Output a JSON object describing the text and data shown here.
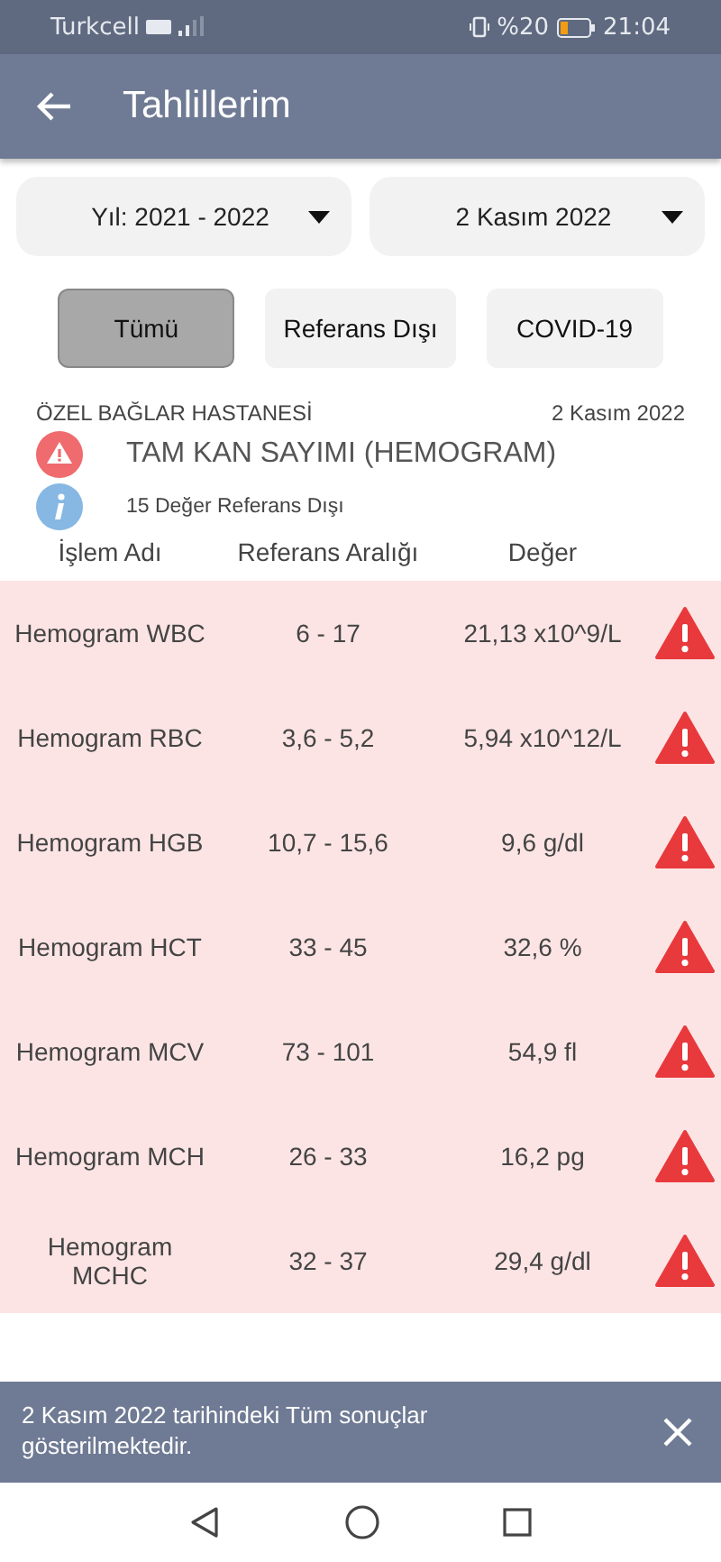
{
  "status_bar": {
    "carrier": "Turkcell",
    "battery": "%20",
    "time": "21:04"
  },
  "header": {
    "title": "Tahlillerim"
  },
  "dropdowns": [
    {
      "value": "Yıl: 2021 - 2022"
    },
    {
      "value": "2 Kasım 2022"
    }
  ],
  "filters": [
    {
      "label": "Tümü",
      "selected": true
    },
    {
      "label": "Referans Dışı",
      "selected": false
    },
    {
      "label": "COVID-19",
      "selected": false
    }
  ],
  "report": {
    "hospital": "ÖZEL BAĞLAR HASTANESİ",
    "date": "2 Kasım 2022",
    "test": "TAM KAN SAYIMI (HEMOGRAM)",
    "summary": "15 Değer Referans Dışı"
  },
  "table": {
    "columns": [
      "İşlem Adı",
      "Referans Aralığı",
      "Değer"
    ],
    "rows": [
      {
        "name": "Hemogram WBC",
        "range": "6 - 17",
        "value": "21,13 x10^9/L",
        "out_of_range": true
      },
      {
        "name": "Hemogram RBC",
        "range": "3,6 - 5,2",
        "value": "5,94 x10^12/L",
        "out_of_range": true
      },
      {
        "name": "Hemogram HGB",
        "range": "10,7 - 15,6",
        "value": "9,6 g/dl",
        "out_of_range": true
      },
      {
        "name": "Hemogram HCT",
        "range": "33 - 45",
        "value": "32,6 %",
        "out_of_range": true
      },
      {
        "name": "Hemogram MCV",
        "range": "73 - 101",
        "value": "54,9 fl",
        "out_of_range": true
      },
      {
        "name": "Hemogram MCH",
        "range": "26 - 33",
        "value": "16,2 pg",
        "out_of_range": true
      },
      {
        "name": "Hemogram MCHC",
        "range": "32 - 37",
        "value": "29,4 g/dl",
        "out_of_range": true
      }
    ]
  },
  "snackbar": {
    "message": "2 Kasım 2022 tarihindeki Tüm sonuçlar gösterilmektedir."
  }
}
